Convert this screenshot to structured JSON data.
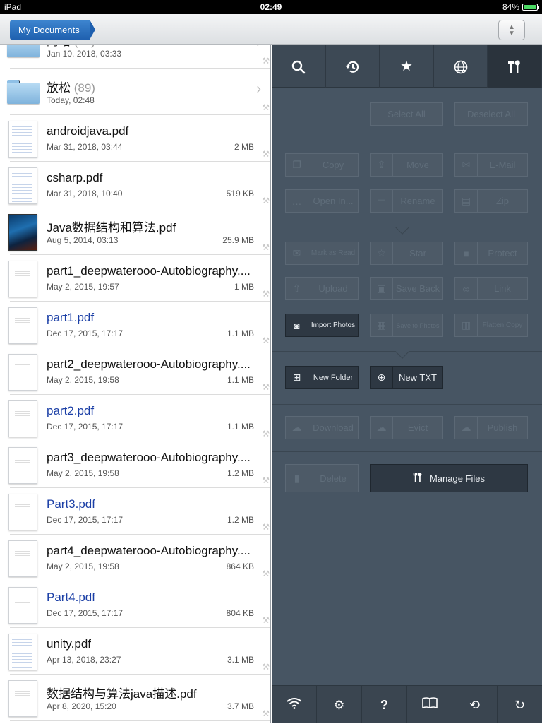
{
  "status": {
    "device": "iPad",
    "time": "02:49",
    "battery": "84%"
  },
  "nav": {
    "breadcrumb": "My Documents"
  },
  "files": [
    {
      "name": "阿曙",
      "count": "(??)",
      "date": "Jan 10, 2018, 03:33",
      "size": "",
      "type": "folder",
      "blue": false
    },
    {
      "name": "放松",
      "count": "(89)",
      "date": "Today, 02:48",
      "size": "",
      "type": "folder",
      "blue": false
    },
    {
      "name": "androidjava.pdf",
      "count": "",
      "date": "Mar 31, 2018, 03:44",
      "size": "2 MB",
      "type": "code",
      "blue": false
    },
    {
      "name": "csharp.pdf",
      "count": "",
      "date": "Mar 31, 2018, 10:40",
      "size": "519 KB",
      "type": "code",
      "blue": false
    },
    {
      "name": "Java数据结构和算法.pdf",
      "count": "",
      "date": "Aug 5, 2014, 03:13",
      "size": "25.9 MB",
      "type": "cover",
      "blue": false
    },
    {
      "name": "part1_deepwaterooo-Autobiography....",
      "count": "",
      "date": "May 2, 2015, 19:57",
      "size": "1 MB",
      "type": "plain",
      "blue": false
    },
    {
      "name": "part1.pdf",
      "count": "",
      "date": "Dec 17, 2015, 17:17",
      "size": "1.1 MB",
      "type": "plain",
      "blue": true
    },
    {
      "name": "part2_deepwaterooo-Autobiography....",
      "count": "",
      "date": "May 2, 2015, 19:58",
      "size": "1.1 MB",
      "type": "plain",
      "blue": false
    },
    {
      "name": "part2.pdf",
      "count": "",
      "date": "Dec 17, 2015, 17:17",
      "size": "1.1 MB",
      "type": "plain",
      "blue": true
    },
    {
      "name": "part3_deepwaterooo-Autobiography....",
      "count": "",
      "date": "May 2, 2015, 19:58",
      "size": "1.2 MB",
      "type": "plain",
      "blue": false
    },
    {
      "name": "Part3.pdf",
      "count": "",
      "date": "Dec 17, 2015, 17:17",
      "size": "1.2 MB",
      "type": "plain",
      "blue": true
    },
    {
      "name": "part4_deepwaterooo-Autobiography....",
      "count": "",
      "date": "May 2, 2015, 19:58",
      "size": "864 KB",
      "type": "plain",
      "blue": false
    },
    {
      "name": "Part4.pdf",
      "count": "",
      "date": "Dec 17, 2015, 17:17",
      "size": "804 KB",
      "type": "plain",
      "blue": true
    },
    {
      "name": "unity.pdf",
      "count": "",
      "date": "Apr 13, 2018, 23:27",
      "size": "3.1 MB",
      "type": "code",
      "blue": false
    },
    {
      "name": "数据结构与算法java描述.pdf",
      "count": "",
      "date": "Apr 8, 2020, 15:20",
      "size": "3.7 MB",
      "type": "plain",
      "blue": false
    }
  ],
  "panel": {
    "tabs": [
      "search",
      "history",
      "favorites",
      "web",
      "tools"
    ],
    "select_all": "Select All",
    "deselect_all": "Deselect All",
    "copy": "Copy",
    "move": "Move",
    "email": "E-Mail",
    "open_in": "Open In...",
    "rename": "Rename",
    "zip": "Zip",
    "mark_as_read": "Mark as Read",
    "star": "Star",
    "protect": "Protect",
    "upload": "Upload",
    "save_back": "Save Back",
    "link": "Link",
    "import_photos": "Import Photos",
    "save_to_photos": "Save to Photos",
    "flatten_copy": "Flatten Copy",
    "new_folder": "New Folder",
    "new_txt": "New TXT",
    "download": "Download",
    "evict": "Evict",
    "publish": "Publish",
    "delete": "Delete",
    "manage_files": "Manage Files"
  },
  "bottom_tabs": [
    "wifi",
    "settings",
    "help",
    "library",
    "sync",
    "refresh"
  ]
}
